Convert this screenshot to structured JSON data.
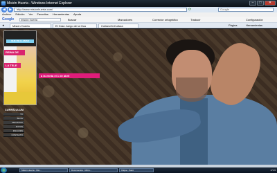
{
  "window": {
    "title": "Misión Huerta - Windows Internet Explorer"
  },
  "address_bar": {
    "url": "http://www.misionhuerta.com/"
  },
  "search_box": {
    "placeholder": "Google"
  },
  "menu": [
    "Archivo",
    "Edición",
    "Ver",
    "Favoritos",
    "Herramientas",
    "Ayuda"
  ],
  "google_toolbar": {
    "logo": "Google",
    "query": "misión huerta",
    "buttons": [
      "Buscar",
      "Marcadores",
      "Corrector ortográfico",
      "Traducir",
      "Configuración"
    ]
  },
  "tabs": [
    {
      "label": "Misión Huerta",
      "active": true
    },
    {
      "label": "El Gran Juego de la Oca",
      "active": false
    },
    {
      "label": "ColiseoOnCultura",
      "active": false
    }
  ],
  "tab_tools": [
    "Página",
    "Herramientas"
  ],
  "site": {
    "promo": "a la venta el 1 de abril",
    "cover": {
      "band_top": "QUE VIE LLAMAN",
      "title_1": "REINA DE",
      "title_2": "LA TELE"
    },
    "nav_heading": "CURRÍCULUM",
    "nav_items": [
      "TV",
      "BLOG",
      "REGISTRO",
      "FOTOS",
      "ENLACES",
      "CONTACTO"
    ]
  },
  "status_bar": {
    "text": ""
  },
  "taskbar": {
    "items": [
      "Misión Huerta - Win...",
      "Documentos - Micro...",
      "Clique - Paint"
    ],
    "clock": "17:45"
  }
}
